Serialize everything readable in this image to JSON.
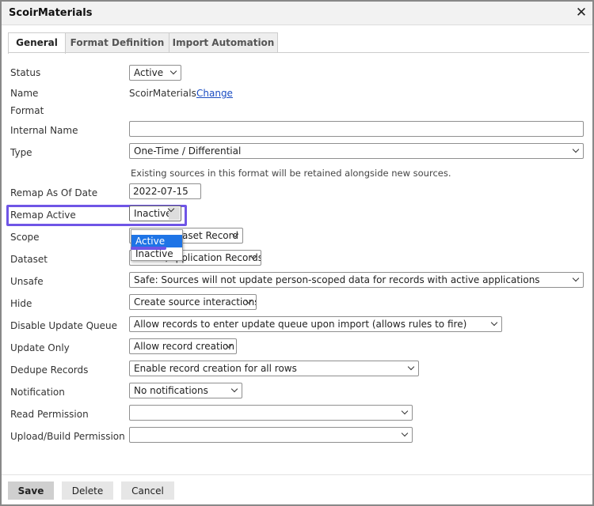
{
  "window": {
    "title": "ScoirMaterials",
    "close_symbol": "✕"
  },
  "tabs": [
    {
      "label": "General",
      "active": true
    },
    {
      "label": "Format Definition",
      "active": false
    },
    {
      "label": "Import Automation",
      "active": false
    }
  ],
  "form": {
    "status": {
      "label": "Status",
      "value": "Active"
    },
    "name": {
      "label": "Name",
      "value": "ScoirMaterials",
      "link": "Change"
    },
    "format": {
      "label": "Format"
    },
    "internal_name": {
      "label": "Internal Name",
      "value": ""
    },
    "type": {
      "label": "Type",
      "value": "One-Time / Differential",
      "hint": "Existing sources in this format will be retained alongside new sources."
    },
    "remap_as_of_date": {
      "label": "Remap As Of Date",
      "value": "2022-07-15"
    },
    "remap_active": {
      "label": "Remap Active",
      "value": "Inactive",
      "options": [
        "Active",
        "Inactive"
      ],
      "highlighted_option": "Active"
    },
    "scope": {
      "label": "Scope",
      "value_partial": "aset Record"
    },
    "dataset": {
      "label": "Dataset",
      "value_partial": "Person/Application Records"
    },
    "unsafe": {
      "label": "Unsafe",
      "value": "Safe: Sources will not update person-scoped data for records with active applications"
    },
    "hide": {
      "label": "Hide",
      "value": "Create source interactions"
    },
    "disable_update_queue": {
      "label": "Disable Update Queue",
      "value": "Allow records to enter update queue upon import (allows rules to fire)"
    },
    "update_only": {
      "label": "Update Only",
      "value": "Allow record creation"
    },
    "dedupe_records": {
      "label": "Dedupe Records",
      "value": "Enable record creation for all rows"
    },
    "notification": {
      "label": "Notification",
      "value": "No notifications"
    },
    "read_permission": {
      "label": "Read Permission",
      "value": ""
    },
    "upload_build_permission": {
      "label": "Upload/Build Permission",
      "value": ""
    }
  },
  "footer": {
    "save": "Save",
    "delete": "Delete",
    "cancel": "Cancel"
  },
  "colors": {
    "highlight": "#6f55e6",
    "selected_option": "#1e74e6",
    "link": "#1a4cc2"
  }
}
